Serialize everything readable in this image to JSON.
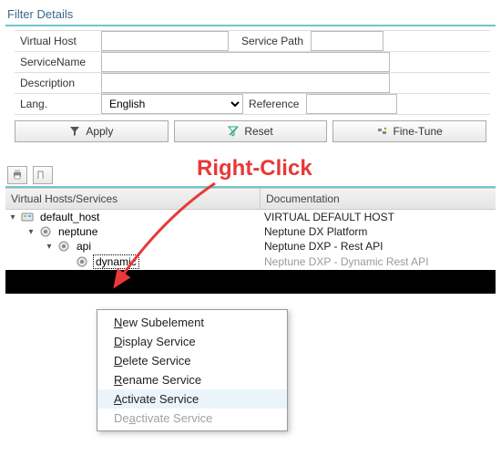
{
  "filter": {
    "title": "Filter Details",
    "labels": {
      "virtual_host": "Virtual Host",
      "service_path": "Service Path",
      "service_name": "ServiceName",
      "description": "Description",
      "lang": "Lang.",
      "reference": "Reference"
    },
    "values": {
      "virtual_host": "",
      "service_path": "",
      "service_name": "",
      "description": "",
      "lang": "English",
      "reference": ""
    },
    "buttons": {
      "apply": "Apply",
      "reset": "Reset",
      "fine_tune": "Fine-Tune"
    }
  },
  "annotation": "Right-Click",
  "tree": {
    "headers": {
      "col1": "Virtual Hosts/Services",
      "col2": "Documentation"
    },
    "rows": [
      {
        "label": "default_host",
        "doc": "VIRTUAL DEFAULT HOST",
        "indent": 0,
        "open": true,
        "icon": "host",
        "selected": false,
        "dim": false
      },
      {
        "label": "neptune",
        "doc": "Neptune DX Platform",
        "indent": 1,
        "open": true,
        "icon": "svc",
        "selected": false,
        "dim": false
      },
      {
        "label": "api",
        "doc": "Neptune DXP - Rest API",
        "indent": 2,
        "open": true,
        "icon": "svc",
        "selected": false,
        "dim": false
      },
      {
        "label": "dynamic",
        "doc": "Neptune DXP - Dynamic Rest API",
        "indent": 3,
        "open": false,
        "icon": "svc",
        "selected": true,
        "dim": true
      }
    ]
  },
  "context_menu": {
    "items": [
      {
        "label": "New Subelement",
        "mn_index": 0,
        "enabled": true,
        "hl": false
      },
      {
        "label": "Display Service",
        "mn_index": 0,
        "enabled": true,
        "hl": false
      },
      {
        "label": "Delete Service",
        "mn_index": 0,
        "enabled": true,
        "hl": false
      },
      {
        "label": "Rename Service",
        "mn_index": 0,
        "enabled": true,
        "hl": false
      },
      {
        "label": "Activate Service",
        "mn_index": 0,
        "enabled": true,
        "hl": true
      },
      {
        "label": "Deactivate Service",
        "mn_index": 2,
        "enabled": false,
        "hl": false
      }
    ]
  },
  "icons": {
    "print": "print-icon",
    "layout": "layout-icon"
  }
}
